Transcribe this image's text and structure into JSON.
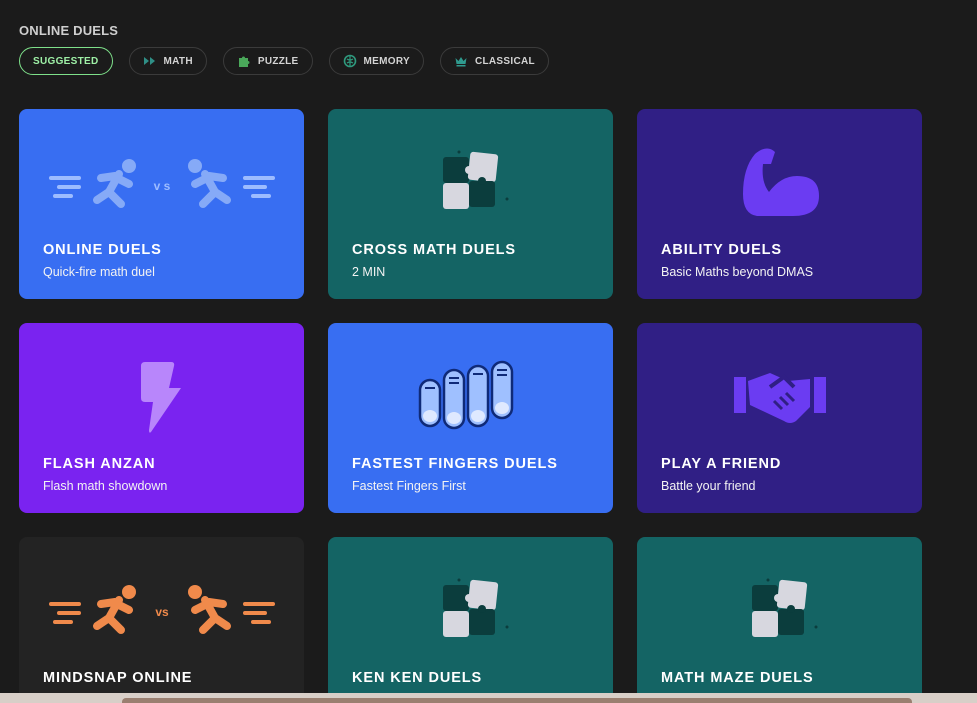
{
  "section": {
    "title": "ONLINE DUELS"
  },
  "filters": [
    {
      "label": "SUGGESTED",
      "icon": "none",
      "active": true
    },
    {
      "label": "MATH",
      "icon": "fast-forward-icon",
      "active": false
    },
    {
      "label": "PUZZLE",
      "icon": "puzzle-icon",
      "active": false
    },
    {
      "label": "MEMORY",
      "icon": "brain-icon",
      "active": false
    },
    {
      "label": "CLASSICAL",
      "icon": "crown-icon",
      "active": false
    }
  ],
  "cards": [
    {
      "title": "ONLINE DUELS",
      "subtitle": "Quick-fire math duel",
      "color": "#386ef2",
      "icon": "runners-vs-icon"
    },
    {
      "title": "CROSS MATH DUELS",
      "subtitle": "2 MIN",
      "color": "#146464",
      "icon": "puzzle-pieces-icon"
    },
    {
      "title": "ABILITY DUELS",
      "subtitle": "Basic Maths beyond DMAS",
      "color": "#301f85",
      "icon": "flexed-arm-icon"
    },
    {
      "title": "FLASH ANZAN",
      "subtitle": "Flash math showdown",
      "color": "#7a23f0",
      "icon": "lightning-icon"
    },
    {
      "title": "FASTEST FINGERS DUELS",
      "subtitle": "Fastest Fingers First",
      "color": "#386ef2",
      "icon": "fingers-icon"
    },
    {
      "title": "PLAY A FRIEND",
      "subtitle": "Battle your friend",
      "color": "#301f85",
      "icon": "handshake-icon"
    },
    {
      "title": "MINDSNAP ONLINE",
      "subtitle": "",
      "color": "#232323",
      "icon": "runners-vs-orange-icon"
    },
    {
      "title": "KEN KEN DUELS",
      "subtitle": "",
      "color": "#146464",
      "icon": "puzzle-pieces-icon"
    },
    {
      "title": "MATH MAZE DUELS",
      "subtitle": "",
      "color": "#146464",
      "icon": "puzzle-pieces-icon"
    }
  ]
}
